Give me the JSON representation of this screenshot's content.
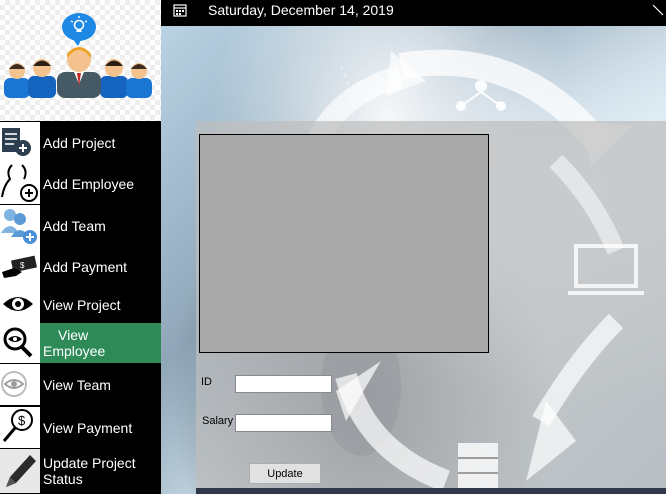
{
  "header": {
    "date": "Saturday, December 14, 2019",
    "calendar_icon": "calendar-icon",
    "corner_icon": "corner-arrow-icon"
  },
  "logo": {
    "icon": "team-lightbulb-logo"
  },
  "sidebar": {
    "items": [
      {
        "label": "Add Project",
        "icon": "document-add-icon"
      },
      {
        "label": "Add Employee",
        "icon": "person-add-icon"
      },
      {
        "label": "Add Team",
        "icon": "team-add-icon"
      },
      {
        "label": "Add Payment",
        "icon": "money-hand-icon"
      },
      {
        "label": "View Project",
        "icon": "eye-icon"
      },
      {
        "label": "View Employee",
        "icon": "magnifier-eye-icon",
        "active": true
      },
      {
        "label": "View Team",
        "icon": "eye-outline-icon"
      },
      {
        "label": "View Payment",
        "icon": "dollar-magnifier-icon"
      },
      {
        "label": "Update Project Status",
        "icon": "pencil-icon"
      }
    ],
    "active_color": "#2e8b57"
  },
  "form": {
    "id_label": "ID",
    "id_value": "",
    "salary_label": "Salary",
    "salary_value": "",
    "update_label": "Update"
  }
}
